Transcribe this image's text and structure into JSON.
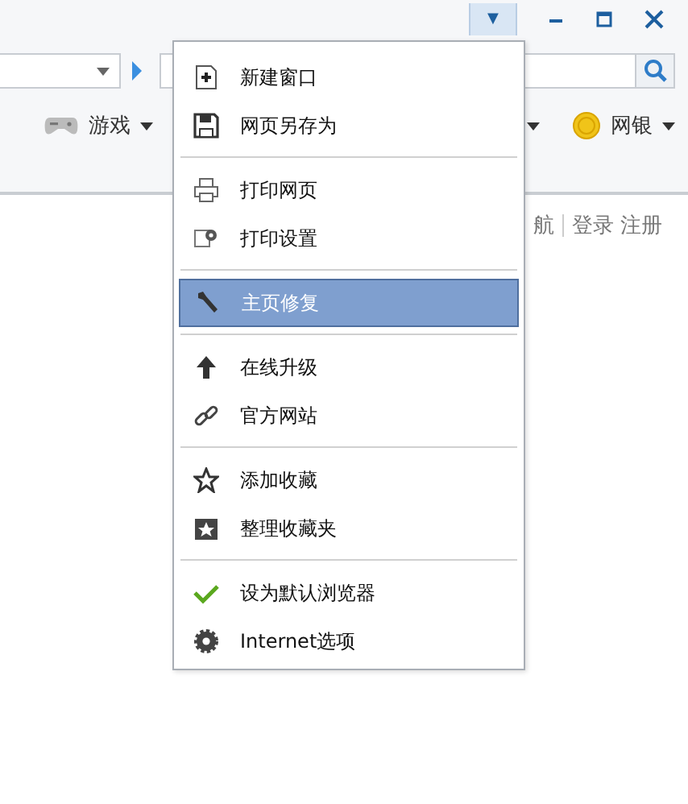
{
  "title_bar": {
    "menu_button": {
      "glyph": "▼",
      "open": true
    }
  },
  "toolbar": [
    {
      "label": "游戏",
      "kind": "game"
    },
    {
      "label": "网银",
      "kind": "coin"
    }
  ],
  "user_links": [
    {
      "label": "航"
    },
    {
      "label": "登录"
    },
    {
      "label": "注册"
    }
  ],
  "menu": {
    "groups": [
      [
        {
          "label": "新建窗口",
          "kind": "new",
          "selected": false
        },
        {
          "label": "网页另存为",
          "kind": "save",
          "selected": false
        }
      ],
      [
        {
          "label": "打印网页",
          "kind": "print",
          "selected": false
        },
        {
          "label": "打印设置",
          "kind": "printsetup",
          "selected": false
        }
      ],
      [
        {
          "label": "主页修复",
          "kind": "repair",
          "selected": true
        }
      ],
      [
        {
          "label": "在线升级",
          "kind": "upgrade",
          "selected": false
        },
        {
          "label": "官方网站",
          "kind": "website",
          "selected": false
        }
      ],
      [
        {
          "label": "添加收藏",
          "kind": "bookmark",
          "selected": false
        },
        {
          "label": "整理收藏夹",
          "kind": "organize",
          "selected": false
        }
      ],
      [
        {
          "label": "设为默认浏览器",
          "kind": "default",
          "selected": false
        },
        {
          "label": "Internet选项",
          "kind": "options",
          "selected": false
        }
      ]
    ]
  }
}
